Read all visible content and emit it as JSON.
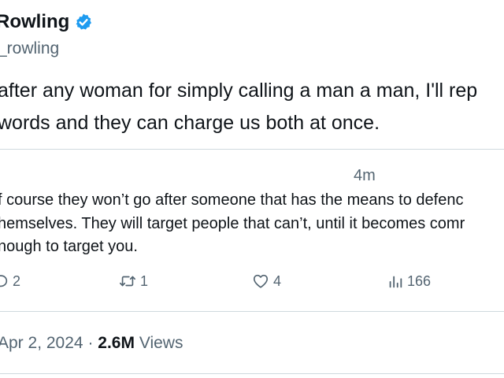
{
  "author": {
    "name": "Rowling",
    "handle": "_rowling",
    "verified_color": "#1d9bf0"
  },
  "tweet": {
    "line1": "after any woman for simply calling a man a man, I'll rep",
    "line2": "words and they can charge us both at once."
  },
  "quoted": {
    "time": "4m",
    "line1": "f course they won’t go after someone that has the means to defenc",
    "line2": "hemselves. They will target people that can’t, until it becomes comr",
    "line3": "nough to target you."
  },
  "actions": {
    "replies": "2",
    "retweets": "1",
    "likes": "4",
    "views": "166"
  },
  "meta": {
    "date": "Apr 2, 2024",
    "separator": "·",
    "views_count": "2.6M",
    "views_label": "Views"
  },
  "icons": [
    "verified-badge-icon",
    "reply-icon",
    "retweet-icon",
    "like-icon",
    "views-icon"
  ]
}
